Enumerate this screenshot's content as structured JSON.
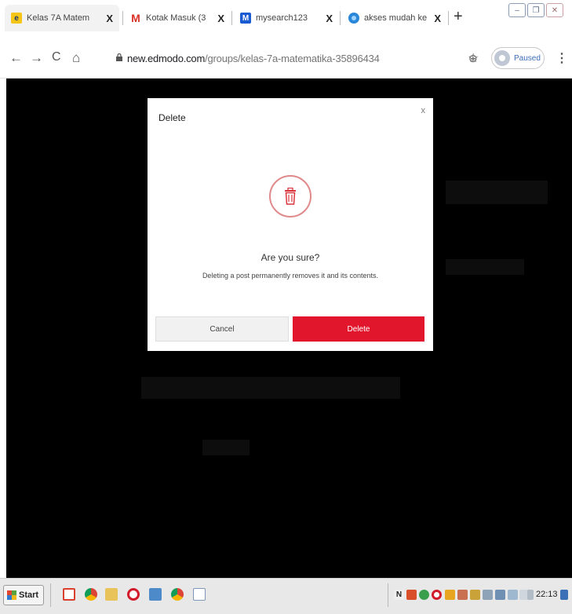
{
  "browser": {
    "tabs": [
      {
        "title": "Kelas 7A Matem",
        "favicon": "edmodo-icon",
        "color": "#f5c518",
        "glyph": "e",
        "active": true
      },
      {
        "title": "Kotak Masuk (3",
        "favicon": "gmail-icon",
        "color": "#d93025",
        "glyph": "M",
        "active": false
      },
      {
        "title": "mysearch123",
        "favicon": "mysearch-icon",
        "color": "#1a5bd1",
        "glyph": "M",
        "active": false
      },
      {
        "title": "akses mudah ke",
        "favicon": "web-icon",
        "color": "#2a86d9",
        "glyph": "",
        "active": false
      }
    ],
    "tab_close_glyph": "X",
    "new_tab_glyph": "+",
    "window_controls": [
      "–",
      "❐",
      "✕"
    ],
    "toolbar": {
      "back_glyph": "←",
      "forward_glyph": "→",
      "reload_glyph": "C",
      "home_glyph": "⌂",
      "url_host": "new.edmodo.com",
      "url_path": "/groups/kelas-7a-matematika-35896434",
      "zoom_glyph": "⊕",
      "star_glyph": "☆",
      "profile_status": "Paused",
      "menu_glyph": "⋮"
    }
  },
  "modal": {
    "title": "Delete",
    "close_glyph": "x",
    "question": "Are you sure?",
    "description": "Deleting a post permanently removes it and its contents.",
    "cancel_label": "Cancel",
    "delete_label": "Delete",
    "icon": "trash-icon",
    "accent_color": "#e1152b",
    "overlay_color": "#000000"
  },
  "taskbar": {
    "start_label": "Start",
    "clock": "22:13",
    "pinned_icons": [
      "office-icon",
      "chrome-icon",
      "folder-icon",
      "opera-icon",
      "notes-icon",
      "chrome-icon",
      "document-icon"
    ],
    "tray_icons": [
      "n-icon",
      "app-icon",
      "globe-icon",
      "opera-icon",
      "shield-icon",
      "users-icon",
      "hand-icon",
      "network-icon",
      "monitor-icon",
      "mouse-icon",
      "flag-icon",
      "volume-icon",
      "battery-icon"
    ],
    "desktop_icon": "show-desktop-icon"
  }
}
